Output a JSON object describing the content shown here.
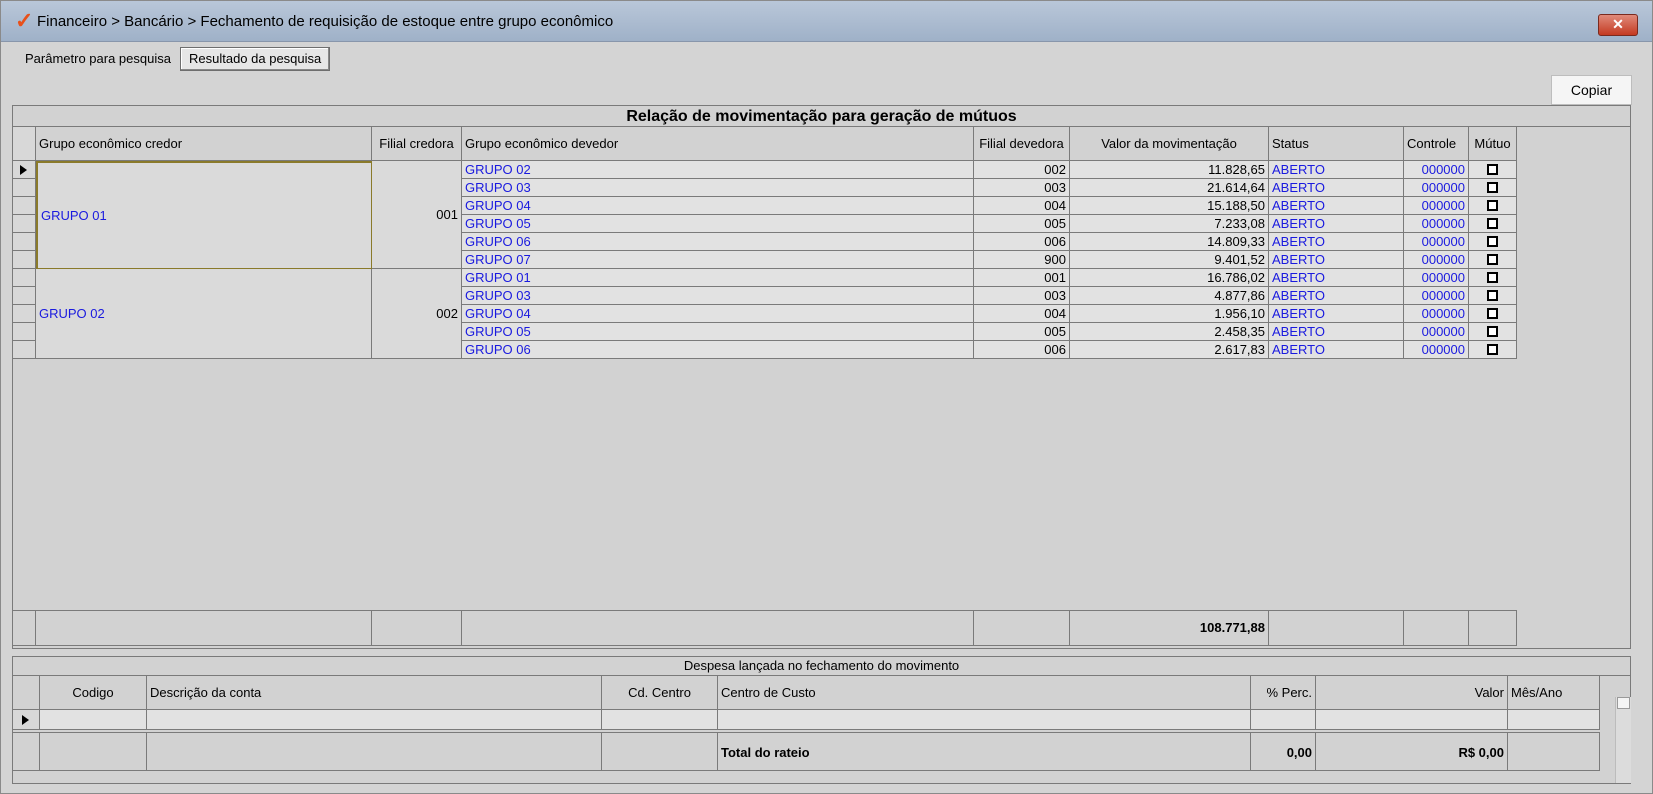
{
  "window": {
    "title": "Financeiro > Bancário > Fechamento de requisição de estoque entre grupo econômico",
    "close_label": "✕"
  },
  "tabs": [
    {
      "label": "Parâmetro para pesquisa",
      "active": false
    },
    {
      "label": "Resultado da pesquisa",
      "active": true
    }
  ],
  "toolbar": {
    "copy_label": "Copiar"
  },
  "movements_grid": {
    "title": "Relação de movimentação para geração de mútuos",
    "columns": [
      "Grupo econômico credor",
      "Filial credora",
      "Grupo econômico devedor",
      "Filial devedora",
      "Valor da movimentação",
      "Status",
      "Controle",
      "Mútuo"
    ],
    "groups": [
      {
        "creditor_group": "GRUPO 01",
        "creditor_branch": "001",
        "rows": [
          {
            "debtor_group": "GRUPO 02",
            "debtor_branch": "002",
            "value": "11.828,65",
            "status": "ABERTO",
            "control": "000000"
          },
          {
            "debtor_group": "GRUPO 03",
            "debtor_branch": "003",
            "value": "21.614,64",
            "status": "ABERTO",
            "control": "000000"
          },
          {
            "debtor_group": "GRUPO 04",
            "debtor_branch": "004",
            "value": "15.188,50",
            "status": "ABERTO",
            "control": "000000"
          },
          {
            "debtor_group": "GRUPO 05",
            "debtor_branch": "005",
            "value": "7.233,08",
            "status": "ABERTO",
            "control": "000000"
          },
          {
            "debtor_group": "GRUPO 06",
            "debtor_branch": "006",
            "value": "14.809,33",
            "status": "ABERTO",
            "control": "000000"
          },
          {
            "debtor_group": "GRUPO 07",
            "debtor_branch": "900",
            "value": "9.401,52",
            "status": "ABERTO",
            "control": "000000"
          }
        ]
      },
      {
        "creditor_group": "GRUPO 02",
        "creditor_branch": "002",
        "rows": [
          {
            "debtor_group": "GRUPO 01",
            "debtor_branch": "001",
            "value": "16.786,02",
            "status": "ABERTO",
            "control": "000000"
          },
          {
            "debtor_group": "GRUPO 03",
            "debtor_branch": "003",
            "value": "4.877,86",
            "status": "ABERTO",
            "control": "000000"
          },
          {
            "debtor_group": "GRUPO 04",
            "debtor_branch": "004",
            "value": "1.956,10",
            "status": "ABERTO",
            "control": "000000"
          },
          {
            "debtor_group": "GRUPO 05",
            "debtor_branch": "005",
            "value": "2.458,35",
            "status": "ABERTO",
            "control": "000000"
          },
          {
            "debtor_group": "GRUPO 06",
            "debtor_branch": "006",
            "value": "2.617,83",
            "status": "ABERTO",
            "control": "000000"
          }
        ]
      }
    ],
    "total_value": "108.771,88"
  },
  "expenses_grid": {
    "title": "Despesa lançada no fechamento do movimento",
    "columns": [
      "Codigo",
      "Descrição da conta",
      "Cd. Centro",
      "Centro de Custo",
      "% Perc.",
      "Valor",
      "Mês/Ano"
    ],
    "total_label": "Total do rateio",
    "total_percent": "0,00",
    "total_value": "R$ 0,00"
  },
  "colors": {
    "link": "#1a1adf",
    "logo": "#e8501a"
  },
  "icons": {
    "logo": "checkmark-logo-icon",
    "row_pointer": "row-pointer-icon",
    "close": "close-icon"
  }
}
